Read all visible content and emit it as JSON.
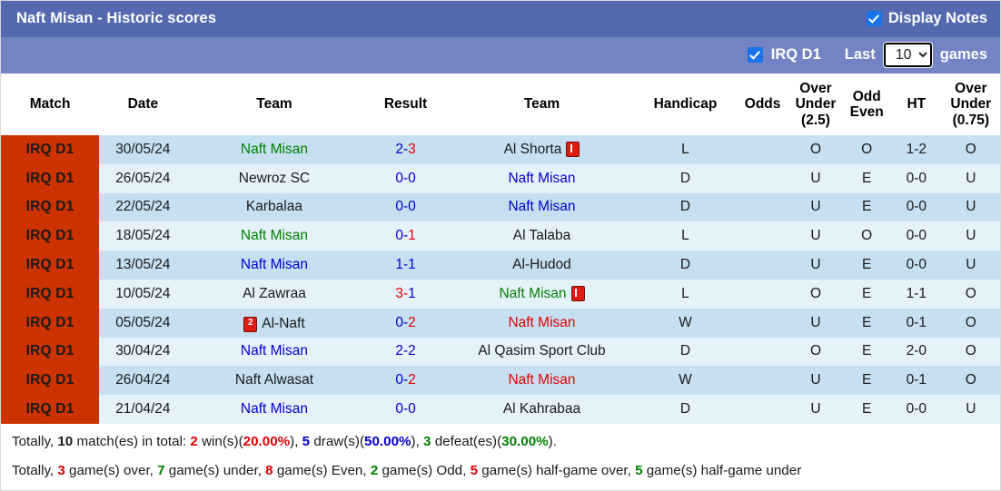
{
  "header": {
    "title": "Naft Misan - Historic scores",
    "display_notes_label": "Display Notes",
    "display_notes_checked": true,
    "league_filter_label": "IRQ D1",
    "league_filter_checked": true,
    "last_label": "Last",
    "games_label": "games",
    "games_value": "10",
    "games_options": [
      "10"
    ]
  },
  "table": {
    "headers": [
      "Match",
      "Date",
      "Team",
      "Result",
      "Team",
      "Handicap",
      "Odds",
      "Over Under (2.5)",
      "Odd Even",
      "HT",
      "Over Under (0.75)"
    ],
    "headers_multiline": {
      "over_under_25": [
        "Over",
        "Under",
        "(2.5)"
      ],
      "odd_even": [
        "Odd",
        "Even"
      ],
      "over_under_075": [
        "Over",
        "Under",
        "(0.75)"
      ]
    },
    "rows": [
      {
        "league": "IRQ D1",
        "date": "30/05/24",
        "home": "Naft Misan",
        "home_color": "green",
        "home_card": "",
        "score_left": "2",
        "score_left_color": "blue",
        "score_right": "3",
        "score_right_color": "red",
        "away": "Al Shorta",
        "away_color": "black",
        "away_card": "plain",
        "handicap": "L",
        "handicap_color": "green",
        "odds": "",
        "ou25": "O",
        "ou25_color": "red",
        "oddeven": "O",
        "oddeven_color": "green",
        "ht": "1-2",
        "ou075": "O",
        "ou075_color": "red"
      },
      {
        "league": "IRQ D1",
        "date": "26/05/24",
        "home": "Newroz SC",
        "home_color": "black",
        "home_card": "",
        "score_left": "0",
        "score_left_color": "blue",
        "score_right": "0",
        "score_right_color": "blue",
        "away": "Naft Misan",
        "away_color": "blue",
        "away_card": "",
        "handicap": "D",
        "handicap_color": "blue",
        "odds": "",
        "ou25": "U",
        "ou25_color": "green",
        "oddeven": "E",
        "oddeven_color": "red",
        "ht": "0-0",
        "ou075": "U",
        "ou075_color": "green"
      },
      {
        "league": "IRQ D1",
        "date": "22/05/24",
        "home": "Karbalaa",
        "home_color": "black",
        "home_card": "",
        "score_left": "0",
        "score_left_color": "blue",
        "score_right": "0",
        "score_right_color": "blue",
        "away": "Naft Misan",
        "away_color": "blue",
        "away_card": "",
        "handicap": "D",
        "handicap_color": "blue",
        "odds": "",
        "ou25": "U",
        "ou25_color": "green",
        "oddeven": "E",
        "oddeven_color": "red",
        "ht": "0-0",
        "ou075": "U",
        "ou075_color": "green"
      },
      {
        "league": "IRQ D1",
        "date": "18/05/24",
        "home": "Naft Misan",
        "home_color": "green",
        "home_card": "",
        "score_left": "0",
        "score_left_color": "blue",
        "score_right": "1",
        "score_right_color": "red",
        "away": "Al Talaba",
        "away_color": "black",
        "away_card": "",
        "handicap": "L",
        "handicap_color": "green",
        "odds": "",
        "ou25": "U",
        "ou25_color": "green",
        "oddeven": "O",
        "oddeven_color": "green",
        "ht": "0-0",
        "ou075": "U",
        "ou075_color": "green"
      },
      {
        "league": "IRQ D1",
        "date": "13/05/24",
        "home": "Naft Misan",
        "home_color": "blue",
        "home_card": "",
        "score_left": "1",
        "score_left_color": "blue",
        "score_right": "1",
        "score_right_color": "blue",
        "away": "Al-Hudod",
        "away_color": "black",
        "away_card": "",
        "handicap": "D",
        "handicap_color": "blue",
        "odds": "",
        "ou25": "U",
        "ou25_color": "green",
        "oddeven": "E",
        "oddeven_color": "red",
        "ht": "0-0",
        "ou075": "U",
        "ou075_color": "green"
      },
      {
        "league": "IRQ D1",
        "date": "10/05/24",
        "home": "Al Zawraa",
        "home_color": "black",
        "home_card": "",
        "score_left": "3",
        "score_left_color": "red",
        "score_right": "1",
        "score_right_color": "blue",
        "away": "Naft Misan",
        "away_color": "green",
        "away_card": "plain",
        "handicap": "L",
        "handicap_color": "green",
        "odds": "",
        "ou25": "O",
        "ou25_color": "red",
        "oddeven": "E",
        "oddeven_color": "red",
        "ht": "1-1",
        "ou075": "O",
        "ou075_color": "red"
      },
      {
        "league": "IRQ D1",
        "date": "05/05/24",
        "home": "Al-Naft",
        "home_color": "black",
        "home_card": "num2",
        "score_left": "0",
        "score_left_color": "blue",
        "score_right": "2",
        "score_right_color": "red",
        "away": "Naft Misan",
        "away_color": "red",
        "away_card": "",
        "handicap": "W",
        "handicap_color": "red",
        "odds": "",
        "ou25": "U",
        "ou25_color": "green",
        "oddeven": "E",
        "oddeven_color": "red",
        "ht": "0-1",
        "ou075": "O",
        "ou075_color": "red"
      },
      {
        "league": "IRQ D1",
        "date": "30/04/24",
        "home": "Naft Misan",
        "home_color": "blue",
        "home_card": "",
        "score_left": "2",
        "score_left_color": "blue",
        "score_right": "2",
        "score_right_color": "blue",
        "away": "Al Qasim Sport Club",
        "away_color": "black",
        "away_card": "",
        "handicap": "D",
        "handicap_color": "blue",
        "odds": "",
        "ou25": "O",
        "ou25_color": "red",
        "oddeven": "E",
        "oddeven_color": "red",
        "ht": "2-0",
        "ou075": "O",
        "ou075_color": "red"
      },
      {
        "league": "IRQ D1",
        "date": "26/04/24",
        "home": "Naft Alwasat",
        "home_color": "black",
        "home_card": "",
        "score_left": "0",
        "score_left_color": "blue",
        "score_right": "2",
        "score_right_color": "red",
        "away": "Naft Misan",
        "away_color": "red",
        "away_card": "",
        "handicap": "W",
        "handicap_color": "red",
        "odds": "",
        "ou25": "U",
        "ou25_color": "green",
        "oddeven": "E",
        "oddeven_color": "red",
        "ht": "0-1",
        "ou075": "O",
        "ou075_color": "red"
      },
      {
        "league": "IRQ D1",
        "date": "21/04/24",
        "home": "Naft Misan",
        "home_color": "blue",
        "home_card": "",
        "score_left": "0",
        "score_left_color": "blue",
        "score_right": "0",
        "score_right_color": "blue",
        "away": "Al Kahrabaa",
        "away_color": "black",
        "away_card": "",
        "handicap": "D",
        "handicap_color": "blue",
        "odds": "",
        "ou25": "U",
        "ou25_color": "green",
        "oddeven": "E",
        "oddeven_color": "red",
        "ht": "0-0",
        "ou075": "U",
        "ou075_color": "green"
      }
    ]
  },
  "summary": {
    "line1": {
      "prefix": "Totally, ",
      "total": "10",
      "after_total": " match(es) in total: ",
      "wins": "2",
      "wins_text": " win(s)(",
      "wins_pct": "20.00%",
      "sep1": "), ",
      "draws": "5",
      "draws_text": " draw(s)(",
      "draws_pct": "50.00%",
      "sep2": "), ",
      "defeats": "3",
      "defeats_text": " defeat(es)(",
      "defeats_pct": "30.00%",
      "suffix": ")."
    },
    "line2": {
      "prefix": "Totally, ",
      "over": "3",
      "over_text": " game(s) over, ",
      "under": "7",
      "under_text": " game(s) under, ",
      "even": "8",
      "even_text": " game(s) Even, ",
      "odd": "2",
      "odd_text": " game(s) Odd, ",
      "half_over": "5",
      "half_over_text": " game(s) half-game over, ",
      "half_under": "5",
      "half_under_text": " game(s) half-game under"
    }
  },
  "colors": {
    "titlebar": "#5569b0",
    "subbar": "#7383c4",
    "league_badge": "#cc3300",
    "row_a": "#c6e0f2",
    "row_b": "#e6f2fa",
    "checkbox": "#1a73e8",
    "green": "#008000",
    "blue": "#0000cc",
    "red": "#e00000"
  }
}
